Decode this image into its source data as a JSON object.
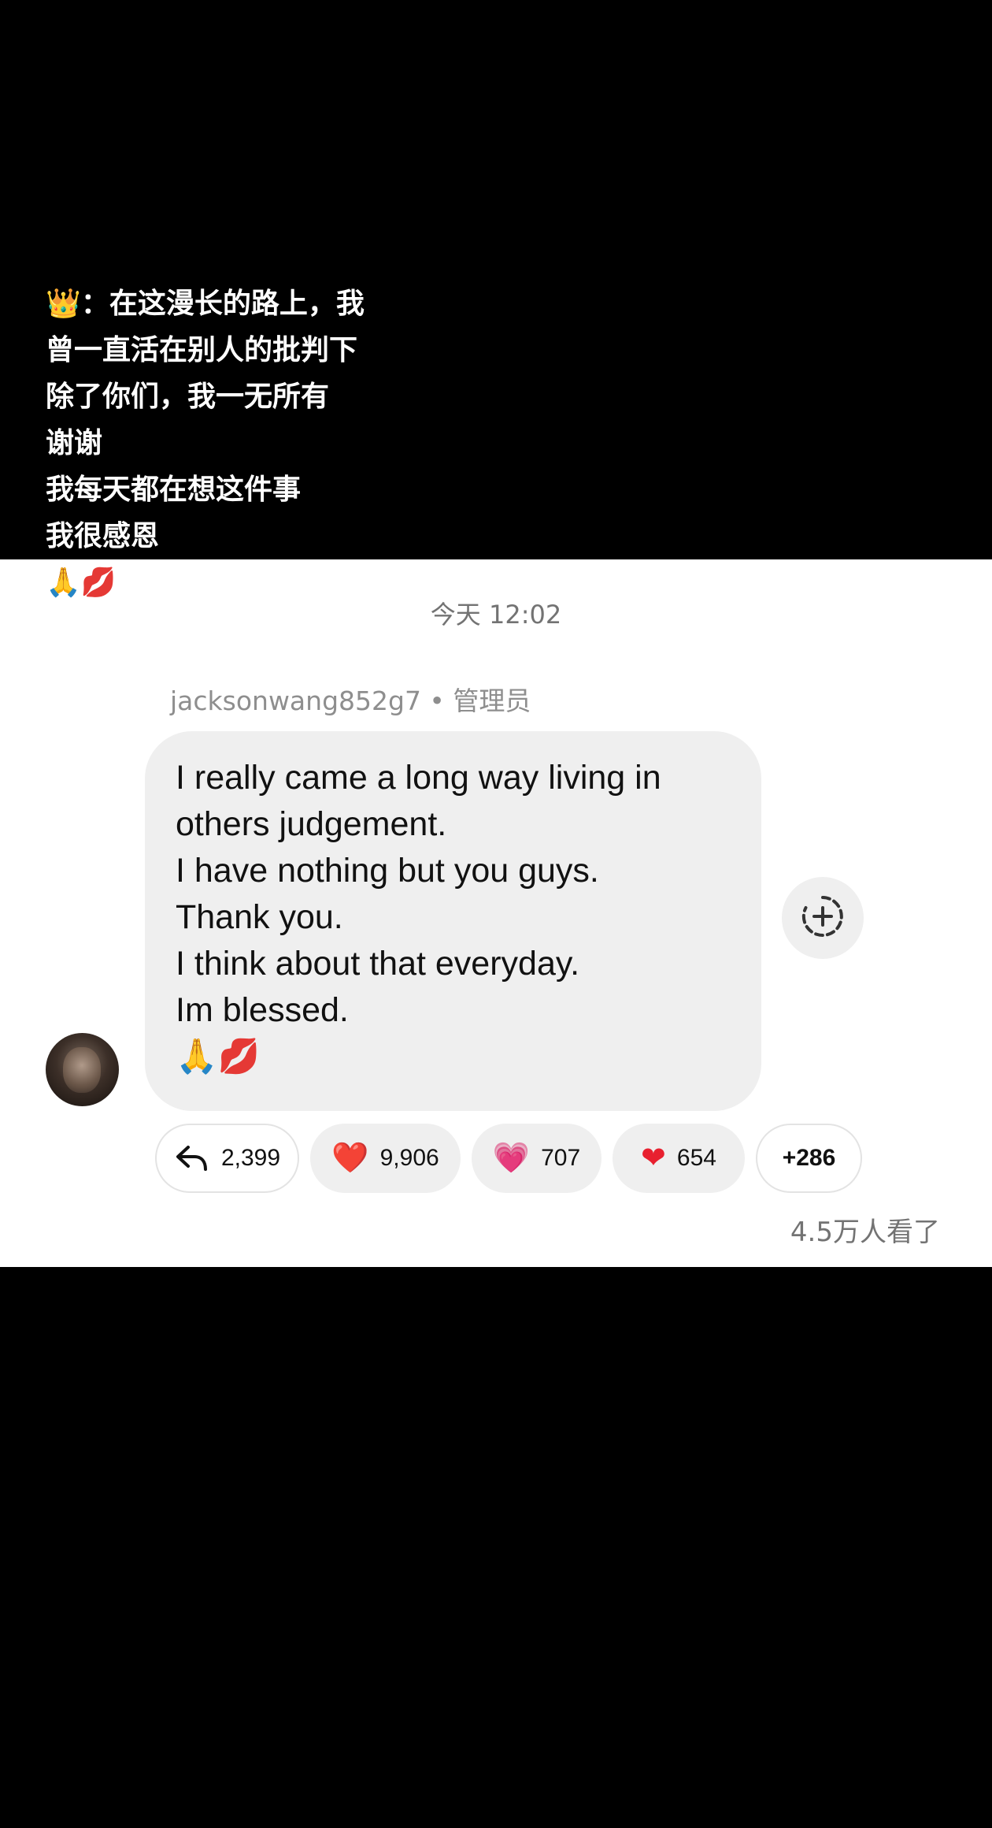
{
  "caption": {
    "lines": [
      "👑：在这漫长的路上，我",
      "曾一直活在别人的批判下",
      "除了你们，我一无所有",
      "谢谢",
      "我每天都在想这件事",
      "我很感恩",
      "🙏💋"
    ]
  },
  "message": {
    "timestamp": "今天 12:02",
    "sender": "jacksonwang852g7 • 管理员",
    "lines": [
      "I really came a long way living in",
      "others judgement.",
      "I have nothing but you guys.",
      "Thank you.",
      "I think about that everyday.",
      "Im blessed.",
      "🙏💋"
    ],
    "avatar_icon": "user-avatar"
  },
  "reactions": {
    "reply": {
      "icon": "reply-arrow-icon",
      "count": "2,399"
    },
    "items": [
      {
        "emoji": "❤️",
        "count": "9,906"
      },
      {
        "emoji": "💗",
        "count": "707"
      },
      {
        "emoji": "❤",
        "count": "654"
      }
    ],
    "more": "+286",
    "add_icon": "add-reaction-icon"
  },
  "footer": {
    "viewers": "4.5万人看了"
  },
  "colors": {
    "background": "#000000",
    "card": "#ffffff",
    "bubble": "#efefef",
    "secondary_text": "#737373",
    "heart_red": "#e8202f",
    "heart_pink": "#ff5fa2"
  }
}
